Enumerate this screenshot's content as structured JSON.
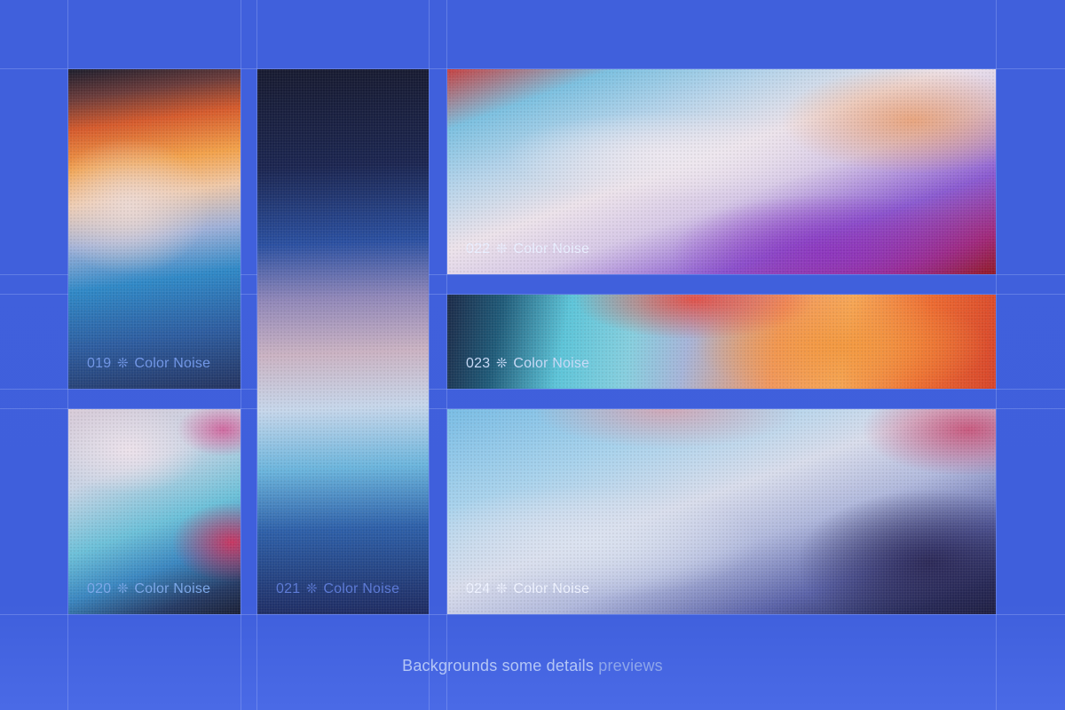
{
  "cards": [
    {
      "id": "019",
      "title": "Color Noise",
      "mark": "❊"
    },
    {
      "id": "020",
      "title": "Color Noise",
      "mark": "❊"
    },
    {
      "id": "021",
      "title": "Color Noise",
      "mark": "❊"
    },
    {
      "id": "022",
      "title": "Color Noise",
      "mark": "❊"
    },
    {
      "id": "023",
      "title": "Color Noise",
      "mark": "❊"
    },
    {
      "id": "024",
      "title": "Color Noise",
      "mark": "❊"
    }
  ],
  "caption": {
    "main": "Backgrounds some details",
    "tail": "previews"
  },
  "colors": {
    "background": "#4060dc",
    "gridline": "#bccdff"
  }
}
